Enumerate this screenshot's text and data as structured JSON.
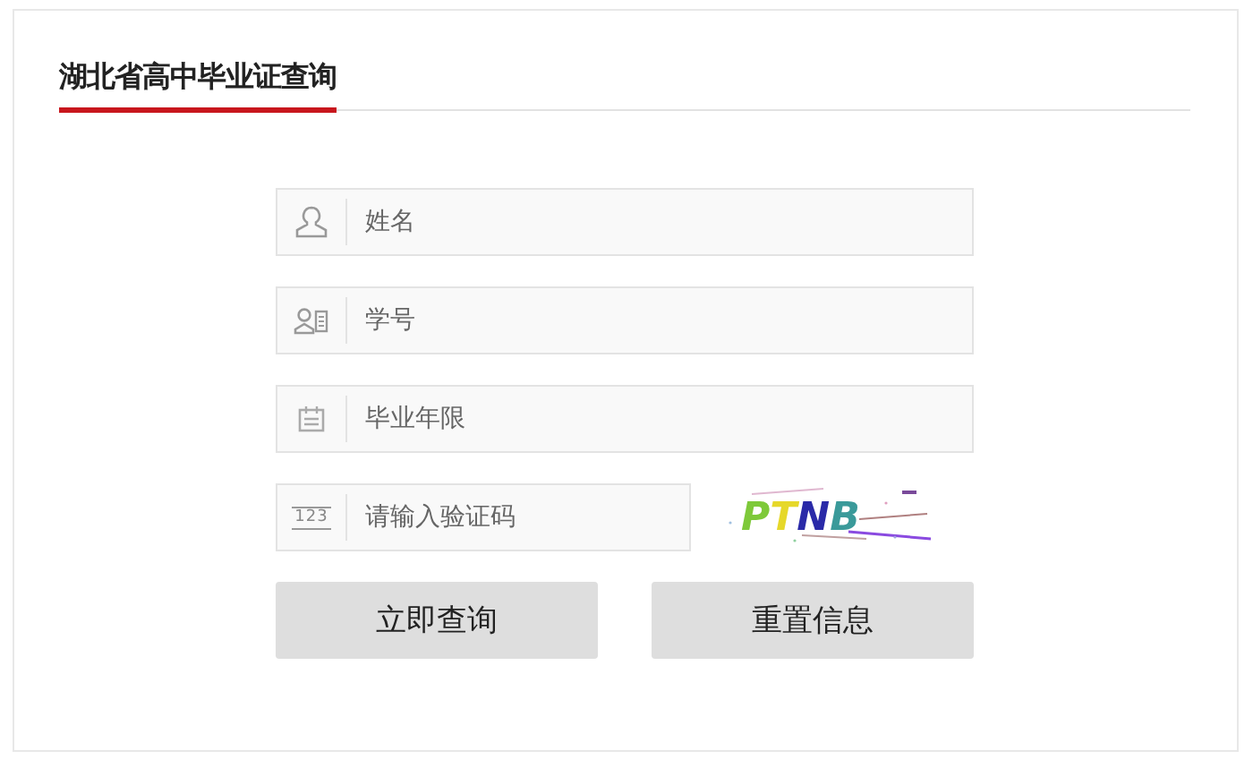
{
  "title": "湖北省高中毕业证查询",
  "fields": [
    {
      "kind": "person",
      "placeholder": "姓名"
    },
    {
      "kind": "id-card",
      "placeholder": "学号"
    },
    {
      "kind": "calendar",
      "placeholder": "毕业年限"
    },
    {
      "kind": "captcha",
      "placeholder": "请输入验证码",
      "icon_label": "123",
      "captcha": "PTNB"
    }
  ],
  "buttons": [
    "立即查询",
    "重置信息"
  ]
}
